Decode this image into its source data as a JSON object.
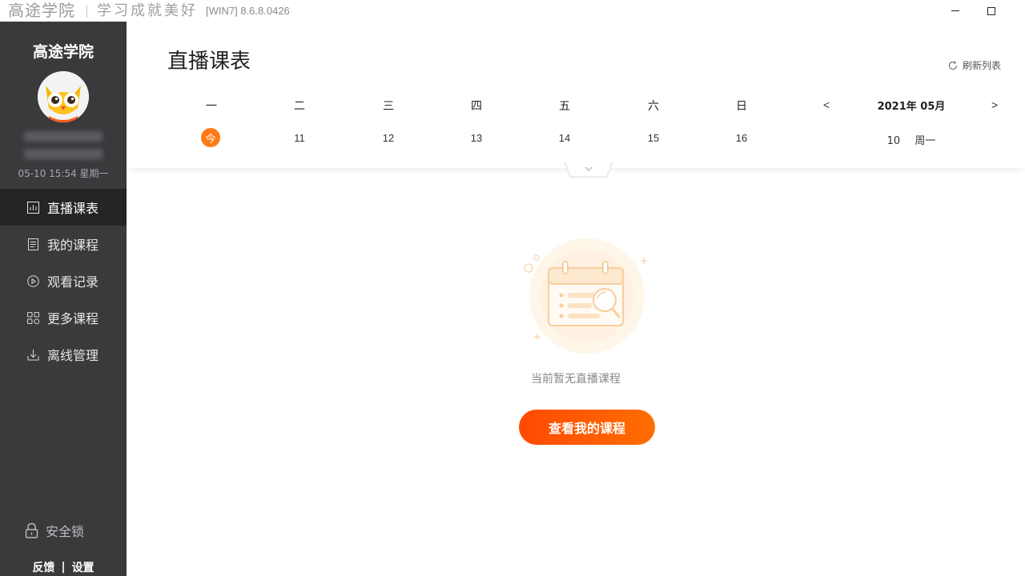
{
  "titlebar": {
    "brand": "高途学院",
    "slogan": "学习成就美好",
    "version": "[WIN7] 8.6.8.0426"
  },
  "sidebar": {
    "brand": "高途学院",
    "datetime": "05-10  15:54  星期一",
    "nav": [
      {
        "label": "直播课表",
        "icon": "chart-icon",
        "active": true
      },
      {
        "label": "我的课程",
        "icon": "document-icon",
        "active": false
      },
      {
        "label": "观看记录",
        "icon": "play-circle-icon",
        "active": false
      },
      {
        "label": "更多课程",
        "icon": "grid-icon",
        "active": false
      },
      {
        "label": "离线管理",
        "icon": "download-icon",
        "active": false
      }
    ],
    "lock_label": "安全锁",
    "feedback_label": "反馈",
    "divider": "|",
    "settings_label": "设置"
  },
  "main": {
    "title": "直播课表",
    "refresh_label": "刷新列表"
  },
  "calendar": {
    "weekdays": [
      "一",
      "二",
      "三",
      "四",
      "五",
      "六",
      "日"
    ],
    "today_badge": "今",
    "dates": [
      "11",
      "12",
      "13",
      "14",
      "15",
      "16"
    ],
    "prev": "<",
    "next": ">",
    "month_label": "2021年 05月",
    "selected_date": "10",
    "selected_weekday": "周一"
  },
  "empty_state": {
    "message": "当前暂无直播课程",
    "button_label": "查看我的课程"
  },
  "colors": {
    "sidebar_bg": "#3a3a3d",
    "sidebar_active_bg": "#252528",
    "accent": "#ff6d00",
    "today_badge": "#ff7a14"
  }
}
